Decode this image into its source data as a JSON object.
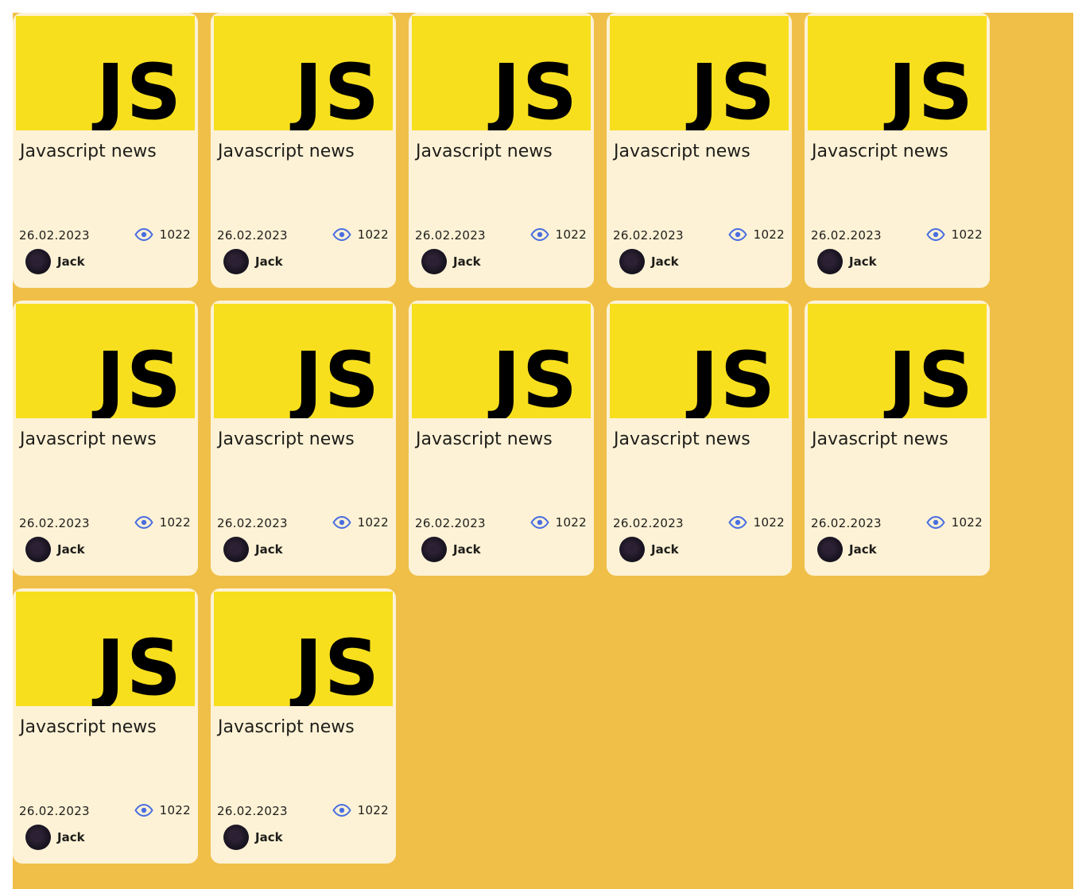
{
  "colors": {
    "page_background": "#f0bf48",
    "card_background": "#fdf2d6",
    "thumbnail_yellow": "#f7df1e",
    "eye_icon": "#4a6ee0"
  },
  "cards": [
    {
      "logo_text": "JS",
      "title": "Javascript news",
      "date": "26.02.2023",
      "views": "1022",
      "author": "Jack",
      "icon": "eye-icon"
    },
    {
      "logo_text": "JS",
      "title": "Javascript news",
      "date": "26.02.2023",
      "views": "1022",
      "author": "Jack",
      "icon": "eye-icon"
    },
    {
      "logo_text": "JS",
      "title": "Javascript news",
      "date": "26.02.2023",
      "views": "1022",
      "author": "Jack",
      "icon": "eye-icon"
    },
    {
      "logo_text": "JS",
      "title": "Javascript news",
      "date": "26.02.2023",
      "views": "1022",
      "author": "Jack",
      "icon": "eye-icon"
    },
    {
      "logo_text": "JS",
      "title": "Javascript news",
      "date": "26.02.2023",
      "views": "1022",
      "author": "Jack",
      "icon": "eye-icon"
    },
    {
      "logo_text": "JS",
      "title": "Javascript news",
      "date": "26.02.2023",
      "views": "1022",
      "author": "Jack",
      "icon": "eye-icon"
    },
    {
      "logo_text": "JS",
      "title": "Javascript news",
      "date": "26.02.2023",
      "views": "1022",
      "author": "Jack",
      "icon": "eye-icon"
    },
    {
      "logo_text": "JS",
      "title": "Javascript news",
      "date": "26.02.2023",
      "views": "1022",
      "author": "Jack",
      "icon": "eye-icon"
    },
    {
      "logo_text": "JS",
      "title": "Javascript news",
      "date": "26.02.2023",
      "views": "1022",
      "author": "Jack",
      "icon": "eye-icon"
    },
    {
      "logo_text": "JS",
      "title": "Javascript news",
      "date": "26.02.2023",
      "views": "1022",
      "author": "Jack",
      "icon": "eye-icon"
    },
    {
      "logo_text": "JS",
      "title": "Javascript news",
      "date": "26.02.2023",
      "views": "1022",
      "author": "Jack",
      "icon": "eye-icon"
    },
    {
      "logo_text": "JS",
      "title": "Javascript news",
      "date": "26.02.2023",
      "views": "1022",
      "author": "Jack",
      "icon": "eye-icon"
    }
  ]
}
